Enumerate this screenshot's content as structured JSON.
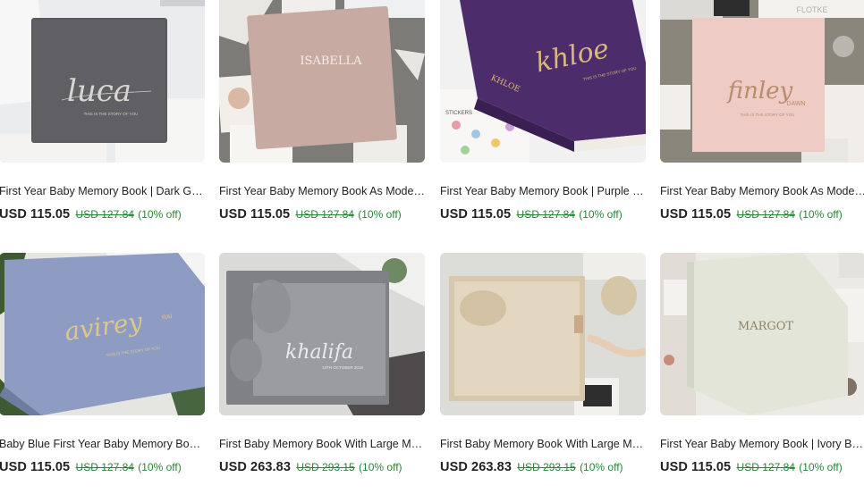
{
  "listings": [
    {
      "title": "First Year Baby Memory Book | Dark Gra...",
      "price": "USD 115.05",
      "original_price": "USD 127.84",
      "discount": "(10% off)",
      "cover_name": "luca",
      "cover_subtitle": "THIS IS THE STORY OF YOU",
      "cover_color": "#5b5b5e",
      "image_bg": "#e9eaec"
    },
    {
      "title": "First Year Baby Memory Book As Moder...",
      "price": "USD 115.05",
      "original_price": "USD 127.84",
      "discount": "(10% off)",
      "cover_name": "ISABELLA",
      "cover_subtitle": "",
      "cover_color": "#c8aca5",
      "image_bg": "#7e7c78"
    },
    {
      "title": "First Year Baby Memory Book | Purple B...",
      "price": "USD 115.05",
      "original_price": "USD 127.84",
      "discount": "(10% off)",
      "cover_name": "khloe",
      "cover_spine": "KHLOE",
      "cover_subtitle": "THIS IS THE STORY OF YOU",
      "cover_color": "#4f2e6e",
      "image_bg": "#efefef"
    },
    {
      "title": "First Year Baby Memory Book As Moder...",
      "price": "USD 115.05",
      "original_price": "USD 127.84",
      "discount": "(10% off)",
      "cover_name": "finley",
      "cover_extra": "DAWN",
      "cover_spine": "FLOTKE",
      "cover_subtitle": "THIS IS THE STORY OF YOU",
      "cover_color": "#f0cdc8",
      "image_bg": "#8b877d"
    },
    {
      "title": "Baby Blue First Year Baby Memory Book...",
      "price": "USD 115.05",
      "original_price": "USD 127.84",
      "discount": "(10% off)",
      "cover_name": "avirey",
      "cover_extra": "RAI",
      "cover_subtitle": "THIS IS THE STORY OF YOU",
      "cover_color": "#8e9cc3",
      "image_bg": "#e6e6e2"
    },
    {
      "title": "First Baby Memory Book With Large Me...",
      "price": "USD 263.83",
      "original_price": "USD 293.15",
      "discount": "(10% off)",
      "cover_name": "khalifa",
      "cover_subtitle": "13TH OCTOBER 2019",
      "cover_color": "#8a8c8e",
      "image_bg": "#d8d8d6"
    },
    {
      "title": "First Baby Memory Book With Large Me...",
      "price": "USD 263.83",
      "original_price": "USD 293.15",
      "discount": "(10% off)",
      "cover_name": "",
      "cover_subtitle": "",
      "cover_color": "#d9cbb2",
      "image_bg": "#dcdcd9"
    },
    {
      "title": "First Year Baby Memory Book | Ivory Ba...",
      "price": "USD 115.05",
      "original_price": "USD 127.84",
      "discount": "(10% off)",
      "cover_name": "MARGOT",
      "cover_subtitle": "",
      "cover_color": "#e4e6da",
      "image_bg": "#ecebe6"
    }
  ],
  "colors": {
    "sale_green": "#258635",
    "text_primary": "#222222"
  }
}
